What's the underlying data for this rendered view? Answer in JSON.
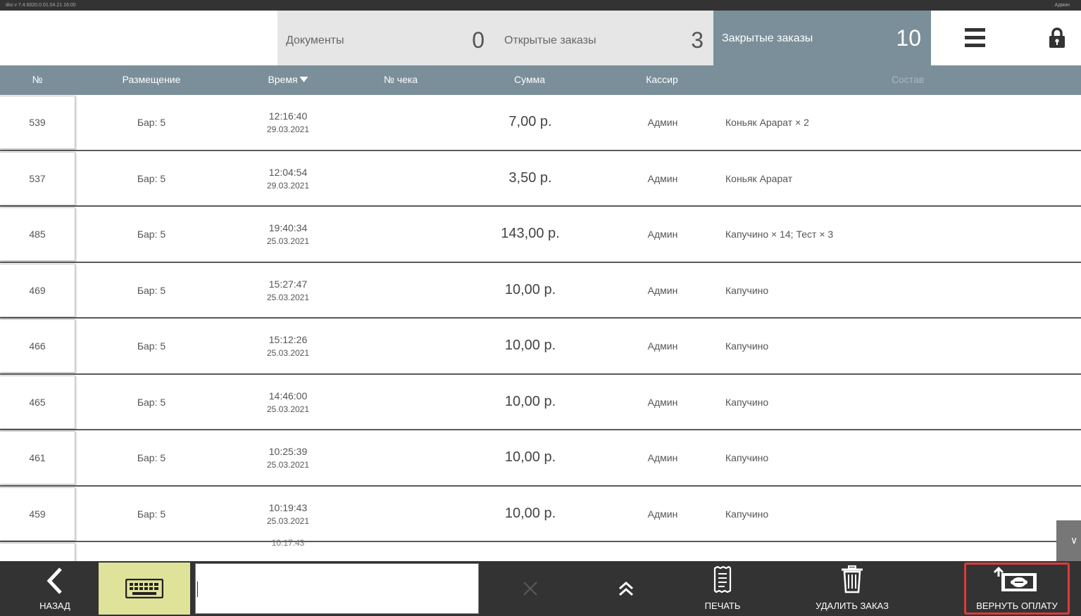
{
  "statusbar": {
    "left_text": "iiko v 7.4.6020.0   01.04.21  16:00",
    "right_text": "Админ"
  },
  "tabs": [
    {
      "label": "Документы",
      "count": "0"
    },
    {
      "label": "Открытые заказы",
      "count": "3"
    },
    {
      "label": "Закрытые заказы",
      "count": "10"
    }
  ],
  "columns": {
    "num": "№",
    "place": "Размещение",
    "time": "Время",
    "check": "№ чека",
    "sum": "Сумма",
    "cashier": "Кассир",
    "items": "Состав"
  },
  "orders": [
    {
      "num": "539",
      "place": "Бар: 5",
      "time": "12:16:40",
      "date": "29.03.2021",
      "sum": "7,00 р.",
      "cashier": "Админ",
      "items": "Коньяк Арарат × 2"
    },
    {
      "num": "537",
      "place": "Бар: 5",
      "time": "12:04:54",
      "date": "29.03.2021",
      "sum": "3,50 р.",
      "cashier": "Админ",
      "items": "Коньяк Арарат"
    },
    {
      "num": "485",
      "place": "Бар: 5",
      "time": "19:40:34",
      "date": "25.03.2021",
      "sum": "143,00 р.",
      "cashier": "Админ",
      "items": "Капучино × 14; Тест × 3"
    },
    {
      "num": "469",
      "place": "Бар: 5",
      "time": "15:27:47",
      "date": "25.03.2021",
      "sum": "10,00 р.",
      "cashier": "Админ",
      "items": "Капучино"
    },
    {
      "num": "466",
      "place": "Бар: 5",
      "time": "15:12:26",
      "date": "25.03.2021",
      "sum": "10,00 р.",
      "cashier": "Админ",
      "items": "Капучино"
    },
    {
      "num": "465",
      "place": "Бар: 5",
      "time": "14:46:00",
      "date": "25.03.2021",
      "sum": "10,00 р.",
      "cashier": "Админ",
      "items": "Капучино"
    },
    {
      "num": "461",
      "place": "Бар: 5",
      "time": "10:25:39",
      "date": "25.03.2021",
      "sum": "10,00 р.",
      "cashier": "Админ",
      "items": "Капучино"
    },
    {
      "num": "459",
      "place": "Бар: 5",
      "time": "10:19:43",
      "date": "25.03.2021",
      "sum": "10,00 р.",
      "cashier": "Админ",
      "items": "Капучино"
    }
  ],
  "partial_row_time": "10:17:43",
  "bottom": {
    "back": "НАЗАД",
    "print": "ПЕЧАТЬ",
    "delete": "УДАЛИТЬ ЗАКАЗ",
    "refund": "ВЕРНУТЬ ОПЛАТУ",
    "search_value": ""
  },
  "colors": {
    "header_bg": "#7a8f99",
    "tab_bg": "#e6e6e6",
    "bottom_bg": "#333333",
    "keyboard_bg": "#dfe39a",
    "refund_highlight": "#e03a3a"
  }
}
